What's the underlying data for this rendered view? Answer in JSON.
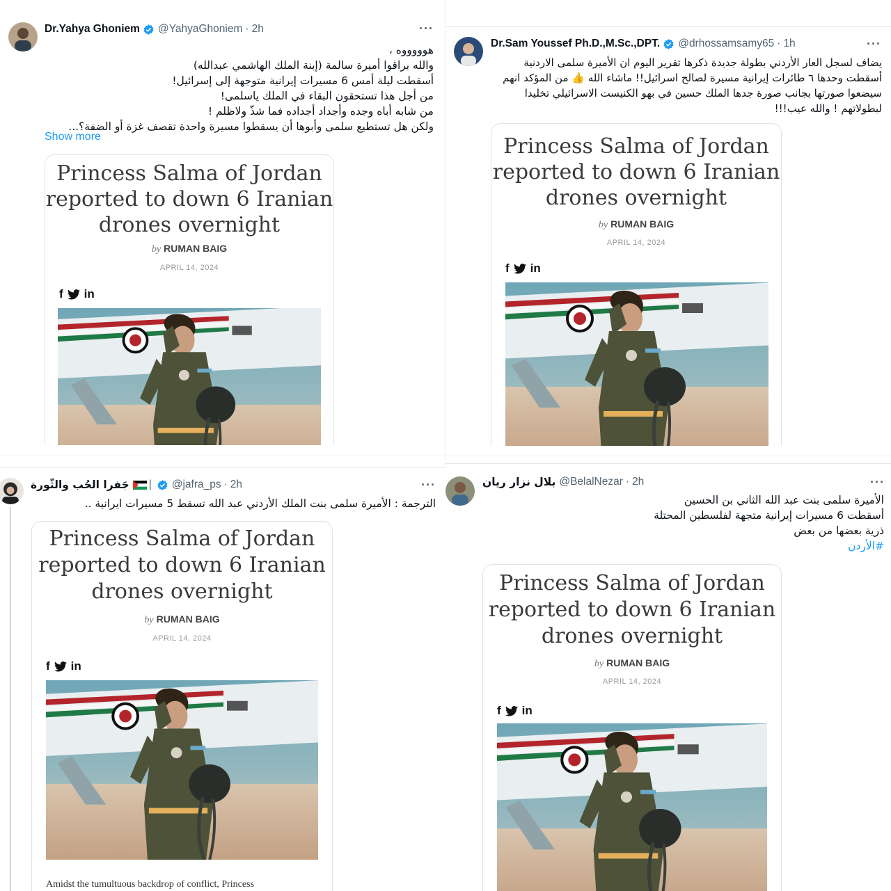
{
  "article": {
    "headline_lines": [
      "Princess Salma of Jordan",
      "reported to down 6 Iranian",
      "drones overnight"
    ],
    "by_prefix": "by",
    "author": "RUMAN BAIG",
    "date": "APRIL 14, 2024",
    "social": {
      "facebook": "f",
      "twitter_icon": "twitter-bird-icon",
      "linkedin": "in"
    },
    "snippet": "Amidst the tumultuous backdrop of conflict, Princess"
  },
  "tweets": [
    {
      "name": "Dr.Yahya Ghoniem",
      "handle": "@YahyaGhoniem",
      "dot": "·",
      "time": "2h",
      "more": "···",
      "lines": [
        "هوووووه ،",
        "والله براڤوا أميرة سالمة (إبنة الملك الهاشمي عبدالله)",
        "أسقطت ليلة أمس 6 مسيرات إيرانية متوجهة إلى إسرائيل!",
        "من أجل هذا تستحقون البقاء في الملك ياسلمى!",
        "من شابه أباه وجده وأجداد أجداده فما شذّ ولاظلم !",
        "ولكن هل تستطيع سلمى وأبوها أن يسقطوا مسيرة واحدة تقصف غزة أو الضفة؟..."
      ],
      "show_more": "Show more"
    },
    {
      "name": "Dr.Sam Youssef Ph.D.,M.Sc.,DPT.",
      "handle": "@drhossamsamy65",
      "dot": "·",
      "time": "1h",
      "more": "···",
      "lines": [
        "يضاف لسجل العار الأردني بطولة جديدة ذكرها تقرير اليوم ان الأميرة سلمى الاردنية",
        "أسقطت وحدها ٦ طائرات إيرانية مسيرة لصالح اسرائيل!! ماشاء الله 👍 من المؤكد انهم",
        "سيضعوا صورتها بجانب صورة جدها الملك حسين في بهو الكنيست الاسرائيلي تخليدا",
        "لبطولاتهم ! والله عيب!!!"
      ]
    },
    {
      "name": "جَفرا الحُب والثّورة",
      "handle": "@jafra_ps",
      "dot": "·",
      "time": "2h",
      "more": "···",
      "flag_icon": "palestine-flag-icon",
      "lines": [
        "الترجمة : الأميرة سلمى بنت الملك الأردني عبد الله تسقط 5 مسيرات ايرانية .."
      ]
    },
    {
      "name": "بلال نزار ريان",
      "handle": "@BelalNezar",
      "dot": "·",
      "time": "2h",
      "more": "···",
      "lines": [
        "الأميرة سلمى بنت عبد الله الثاني بن الحسين",
        "أسقطت 6 مسيرات إيرانية متجهة لفلسطين المحتلة",
        "ذرية بعضها من بعض"
      ],
      "hashtag": "#الأردن"
    }
  ],
  "colors": {
    "link": "#1d9bf0",
    "verified": "#1d9bf0",
    "muted": "#536471"
  }
}
